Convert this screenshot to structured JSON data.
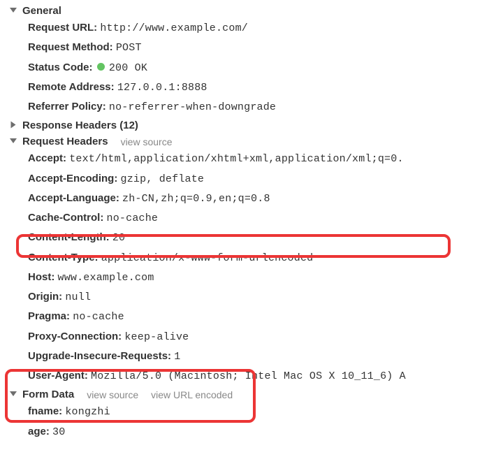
{
  "sections": {
    "general": {
      "title": "General",
      "items": [
        {
          "key": "Request URL:",
          "value": "http://www.example.com/"
        },
        {
          "key": "Request Method:",
          "value": "POST"
        },
        {
          "key": "Status Code:",
          "value": "200 OK",
          "status_dot": true
        },
        {
          "key": "Remote Address:",
          "value": "127.0.0.1:8888"
        },
        {
          "key": "Referrer Policy:",
          "value": "no-referrer-when-downgrade"
        }
      ]
    },
    "response_headers": {
      "title": "Response Headers (12)"
    },
    "request_headers": {
      "title": "Request Headers",
      "view_source": "view source",
      "items": [
        {
          "key": "Accept:",
          "value": "text/html,application/xhtml+xml,application/xml;q=0."
        },
        {
          "key": "Accept-Encoding:",
          "value": "gzip, deflate"
        },
        {
          "key": "Accept-Language:",
          "value": "zh-CN,zh;q=0.9,en;q=0.8"
        },
        {
          "key": "Cache-Control:",
          "value": "no-cache"
        },
        {
          "key": "Content-Length:",
          "value": "20"
        },
        {
          "key": "Content-Type:",
          "value": "application/x-www-form-urlencoded"
        },
        {
          "key": "Host:",
          "value": "www.example.com"
        },
        {
          "key": "Origin:",
          "value": "null"
        },
        {
          "key": "Pragma:",
          "value": "no-cache"
        },
        {
          "key": "Proxy-Connection:",
          "value": "keep-alive"
        },
        {
          "key": "Upgrade-Insecure-Requests:",
          "value": "1"
        },
        {
          "key": "User-Agent:",
          "value": "Mozilla/5.0 (Macintosh; Intel Mac OS X 10_11_6) A"
        }
      ]
    },
    "form_data": {
      "title": "Form Data",
      "view_source": "view source",
      "view_url_encoded": "view URL encoded",
      "items": [
        {
          "key": "fname:",
          "value": "kongzhi"
        },
        {
          "key": "age:",
          "value": "30"
        }
      ]
    }
  }
}
